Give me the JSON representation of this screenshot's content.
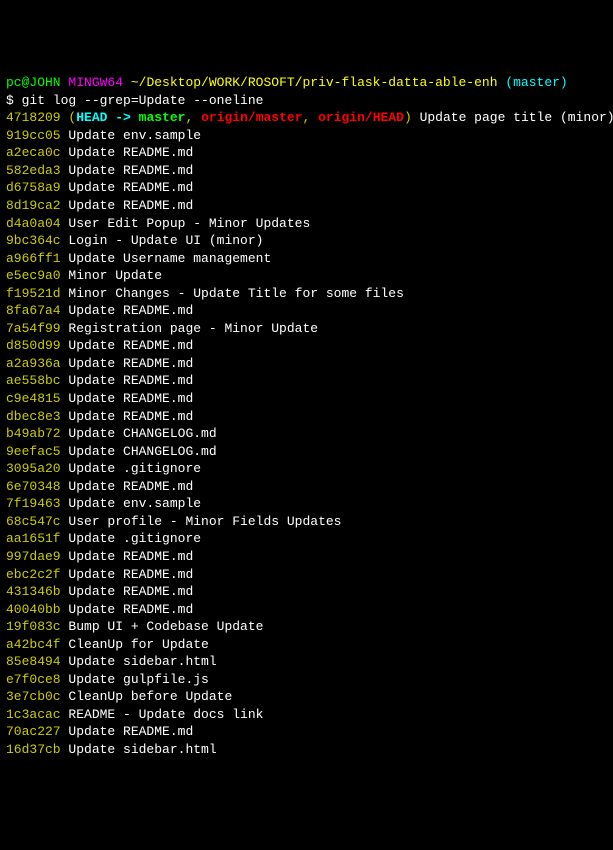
{
  "prompt": {
    "user": "pc@JOHN",
    "env": "MINGW64",
    "path": "~/Desktop/WORK/ROSOFT/priv-flask-datta-able-enh",
    "branch": "(master)",
    "symbol": "$",
    "command": "git log --grep=Update --oneline"
  },
  "head_commit": {
    "hash": "4718209",
    "open_paren": "(",
    "head_label": "HEAD",
    "arrow": " -> ",
    "local_branch": "master",
    "comma1": ", ",
    "remote_master": "origin/master",
    "comma2": ", ",
    "remote_head": "origin/HEAD",
    "close_paren": ")",
    "message": " Update page title (minor)"
  },
  "commits": [
    {
      "hash": "919cc05",
      "message": "Update env.sample"
    },
    {
      "hash": "a2eca0c",
      "message": "Update README.md"
    },
    {
      "hash": "582eda3",
      "message": "Update README.md"
    },
    {
      "hash": "d6758a9",
      "message": "Update README.md"
    },
    {
      "hash": "8d19ca2",
      "message": "Update README.md"
    },
    {
      "hash": "d4a0a04",
      "message": "User Edit Popup - Minor Updates"
    },
    {
      "hash": "9bc364c",
      "message": "Login - Update UI (minor)"
    },
    {
      "hash": "a966ff1",
      "message": "Update Username management"
    },
    {
      "hash": "e5ec9a0",
      "message": "Minor Update"
    },
    {
      "hash": "f19521d",
      "message": "Minor Changes - Update Title for some files"
    },
    {
      "hash": "8fa67a4",
      "message": "Update README.md"
    },
    {
      "hash": "7a54f99",
      "message": "Registration page - Minor Update"
    },
    {
      "hash": "d850d99",
      "message": "Update README.md"
    },
    {
      "hash": "a2a936a",
      "message": "Update README.md"
    },
    {
      "hash": "ae558bc",
      "message": "Update README.md"
    },
    {
      "hash": "c9e4815",
      "message": "Update README.md"
    },
    {
      "hash": "dbec8e3",
      "message": "Update README.md"
    },
    {
      "hash": "b49ab72",
      "message": "Update CHANGELOG.md"
    },
    {
      "hash": "9eefac5",
      "message": "Update CHANGELOG.md"
    },
    {
      "hash": "3095a20",
      "message": "Update .gitignore"
    },
    {
      "hash": "6e70348",
      "message": "Update README.md"
    },
    {
      "hash": "7f19463",
      "message": "Update env.sample"
    },
    {
      "hash": "68c547c",
      "message": "User profile - Minor Fields Updates"
    },
    {
      "hash": "aa1651f",
      "message": "Update .gitignore"
    },
    {
      "hash": "997dae9",
      "message": "Update README.md"
    },
    {
      "hash": "ebc2c2f",
      "message": "Update README.md"
    },
    {
      "hash": "431346b",
      "message": "Update README.md"
    },
    {
      "hash": "40040bb",
      "message": "Update README.md"
    },
    {
      "hash": "19f083c",
      "message": "Bump UI + Codebase Update"
    },
    {
      "hash": "a42bc4f",
      "message": "CleanUp for Update"
    },
    {
      "hash": "85e8494",
      "message": "Update sidebar.html"
    },
    {
      "hash": "e7f0ce8",
      "message": "Update gulpfile.js"
    },
    {
      "hash": "3e7cb0c",
      "message": "CleanUp before Update"
    },
    {
      "hash": "1c3acac",
      "message": "README - Update docs link"
    },
    {
      "hash": "70ac227",
      "message": "Update README.md"
    },
    {
      "hash": "16d37cb",
      "message": "Update sidebar.html"
    }
  ]
}
